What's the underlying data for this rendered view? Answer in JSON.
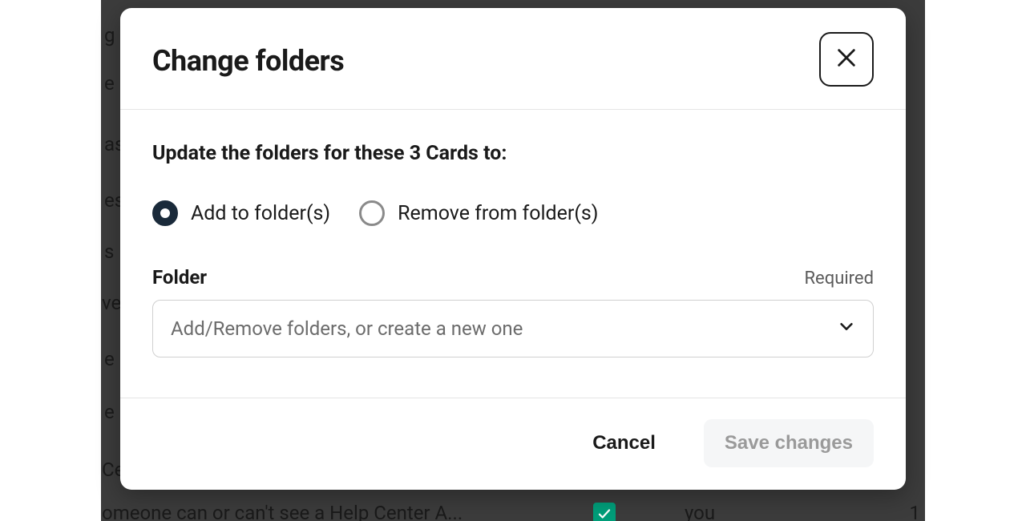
{
  "modal": {
    "title": "Change folders",
    "subhead": "Update the folders for these 3 Cards to:",
    "radio": {
      "add": "Add to folder(s)",
      "remove": "Remove from folder(s)",
      "selected": "add"
    },
    "field": {
      "label": "Folder",
      "hint": "Required",
      "placeholder": "Add/Remove folders, or create a new one"
    },
    "footer": {
      "cancel": "Cancel",
      "save": "Save changes"
    }
  },
  "background": {
    "frag1": "g",
    "frag2": "e C",
    "frag3": "as",
    "frag4": "es",
    "frag5": "s",
    "frag6": "ve",
    "frag7": "e",
    "frag8": "e",
    "frag9": "Ce",
    "frag10": "omeone can or can't see a Help Center A...",
    "frag11": "you",
    "frag12": "1"
  }
}
